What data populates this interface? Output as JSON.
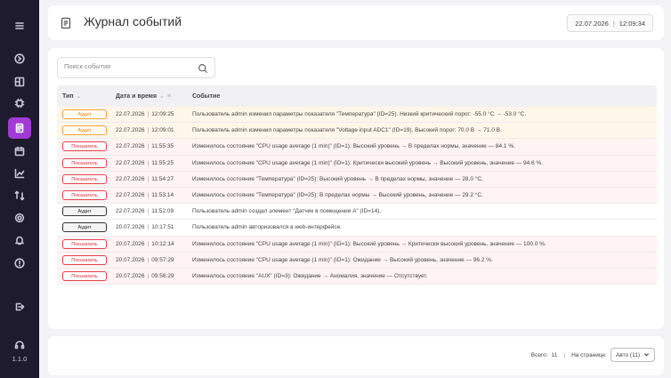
{
  "app": {
    "version": "1.1.0"
  },
  "header": {
    "title": "Журнал событий",
    "date": "22.07.2026",
    "time": "12:09:34"
  },
  "search": {
    "placeholder": "Поиск события",
    "value": ""
  },
  "table": {
    "columns": {
      "type": "Тип",
      "datetime": "Дата и время",
      "event": "Событие"
    },
    "rows": [
      {
        "kind": "audit-warn",
        "type": "Аудит",
        "date": "22.07.2026",
        "time": "12:09:25",
        "event": "Пользователь admin изменил параметры показателя \"Температура\" (ID=25). Низкий критический порог: -55.0 °C → -53.0 °C."
      },
      {
        "kind": "audit-warn",
        "type": "Аудит",
        "date": "22.07.2026",
        "time": "12:09:01",
        "event": "Пользователь admin изменил параметры показателя \"Voltage input ADC1\" (ID=19). Высокий порог: 70.0 В → 71.0 В."
      },
      {
        "kind": "indicator",
        "type": "Показатель",
        "date": "22.07.2026",
        "time": "11:55:35",
        "event": "Изменилось состояние \"CPU usage average (1 min)\" (ID=1): Высокий уровень → В пределах нормы, значение — 84.1 %."
      },
      {
        "kind": "indicator",
        "type": "Показатель",
        "date": "22.07.2026",
        "time": "11:55:25",
        "event": "Изменилось состояние \"CPU usage average (1 min)\" (ID=1): Критически высокий уровень → Высокий уровень, значение — 94.6 %."
      },
      {
        "kind": "indicator",
        "type": "Показатель",
        "date": "22.07.2026",
        "time": "11:54:27",
        "event": "Изменилось состояние \"Температура\" (ID=25): Высокий уровень → В пределах нормы, значение — 28.0 °C."
      },
      {
        "kind": "indicator",
        "type": "Показатель",
        "date": "22.07.2026",
        "time": "11:53:14",
        "event": "Изменилось состояние \"Температура\" (ID=25): В пределах нормы → Высокий уровень, значение — 29.2 °C."
      },
      {
        "kind": "audit",
        "type": "Аудит",
        "date": "22.07.2026",
        "time": "11:52:09",
        "event": "Пользователь admin создал элемент \"Датчик в помещении А\" (ID=14)."
      },
      {
        "kind": "audit",
        "type": "Аудит",
        "date": "20.07.2026",
        "time": "10:17:51",
        "event": "Пользователь admin авторизовался в web-интерфейсе."
      },
      {
        "kind": "indicator",
        "type": "Показатель",
        "date": "20.07.2026",
        "time": "10:12:14",
        "event": "Изменилось состояние \"CPU usage average (1 min)\" (ID=1): Высокий уровень → Критически высокий уровень, значение — 100.0 %."
      },
      {
        "kind": "indicator",
        "type": "Показатель",
        "date": "20.07.2026",
        "time": "09:57:29",
        "event": "Изменилось состояние \"CPU usage average (1 min)\" (ID=1): Ожидание → Высокий уровень, значение — 96.2 %."
      },
      {
        "kind": "indicator",
        "type": "Показатель",
        "date": "20.07.2026",
        "time": "09:56:29",
        "event": "Изменилось состояние \"AUX\" (ID=3): Ожидание → Аномалия, значение — Отсутствует."
      }
    ]
  },
  "footer": {
    "total_label": "Всего:",
    "total": "11",
    "per_page_label": "На странице:",
    "per_page_value": "Авто (11)"
  },
  "colors": {
    "sidebar": "#1e1b2e",
    "accent": "#a23bd4",
    "audit_warn": "#f0a340",
    "indicator": "#e0424f"
  }
}
